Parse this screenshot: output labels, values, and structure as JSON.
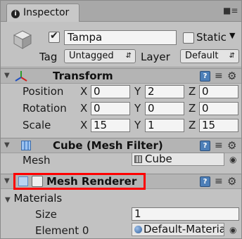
{
  "tab": {
    "title": "Inspector",
    "info_icon": "info-icon",
    "lock_icon": "lock-icon"
  },
  "header": {
    "object_name": "Tampa",
    "active_checked": true,
    "static_label": "Static",
    "static_checked": false,
    "tag_label": "Tag",
    "tag_value": "Untagged",
    "layer_label": "Layer",
    "layer_value": "Default"
  },
  "transform": {
    "title": "Transform",
    "rows": [
      {
        "label": "Position",
        "x": "0",
        "y": "2",
        "z": "0"
      },
      {
        "label": "Rotation",
        "x": "0",
        "y": "0",
        "z": "0"
      },
      {
        "label": "Scale",
        "x": "15",
        "y": "1",
        "z": "15"
      }
    ],
    "axis_labels": {
      "x": "X",
      "y": "Y",
      "z": "Z"
    }
  },
  "mesh_filter": {
    "title": "Cube (Mesh Filter)",
    "mesh_label": "Mesh",
    "mesh_value": "Cube"
  },
  "mesh_renderer": {
    "title": "Mesh Renderer",
    "enabled": false,
    "materials_label": "Materials",
    "size_label": "Size",
    "size_value": "1",
    "element_label": "Element 0",
    "element_value": "Default-Materia"
  },
  "colors": {
    "highlight": "#ff0000",
    "panel": "#c2c2c2",
    "component_header": "#b4b4b4"
  }
}
